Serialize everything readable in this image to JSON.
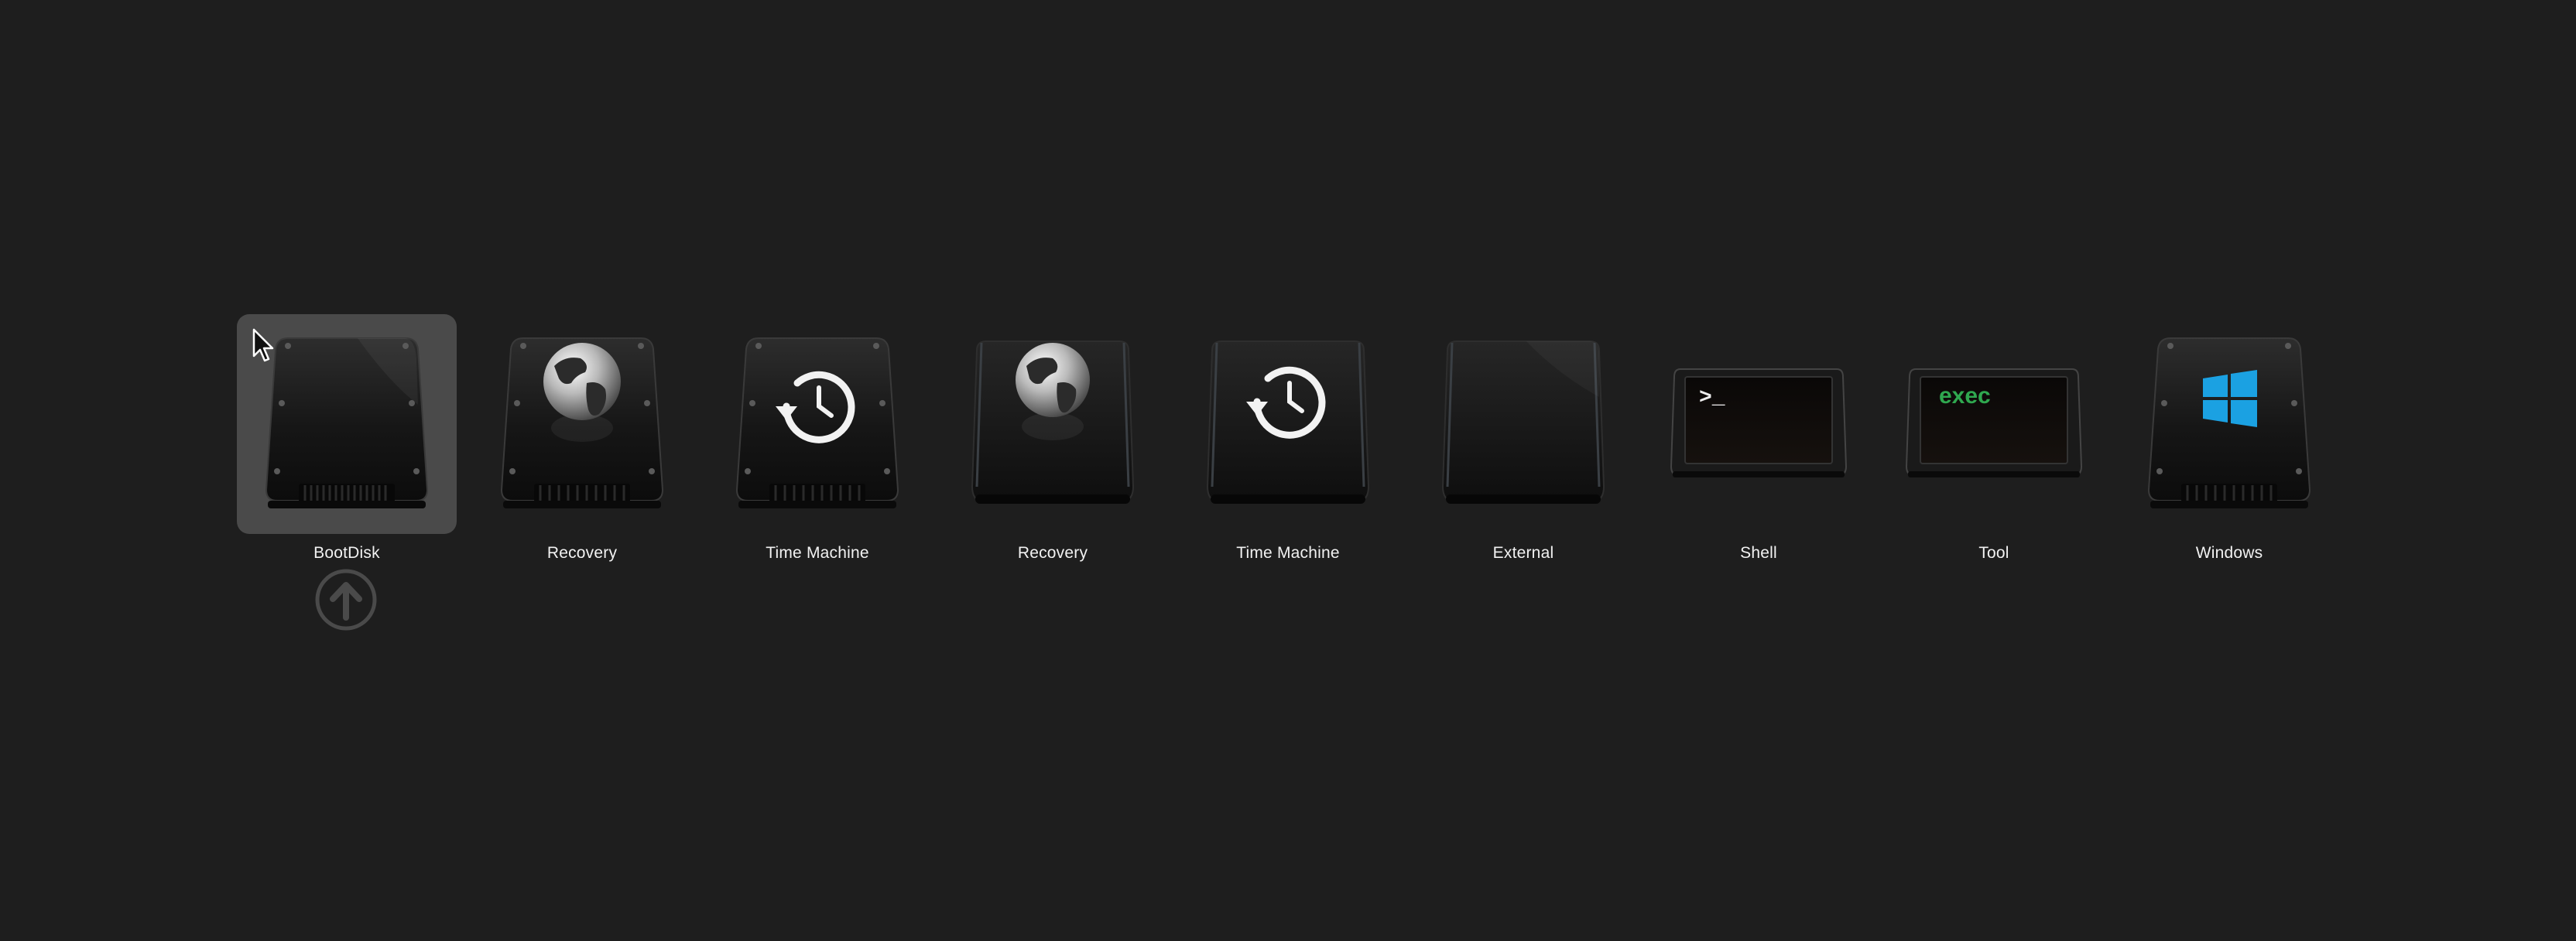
{
  "picker": {
    "entries": [
      {
        "label": "BootDisk",
        "icon": "hard-drive-icon",
        "selected": true
      },
      {
        "label": "Recovery",
        "icon": "recovery-globe-drive-icon",
        "selected": false
      },
      {
        "label": "Time Machine",
        "icon": "time-machine-drive-icon",
        "selected": false
      },
      {
        "label": "Recovery",
        "icon": "recovery-globe-external-drive-icon",
        "selected": false
      },
      {
        "label": "Time Machine",
        "icon": "time-machine-external-drive-icon",
        "selected": false
      },
      {
        "label": "External",
        "icon": "external-drive-icon",
        "selected": false
      },
      {
        "label": "Shell",
        "icon": "shell-terminal-icon",
        "prompt": ">_",
        "selected": false
      },
      {
        "label": "Tool",
        "icon": "tool-exec-icon",
        "text": "exec",
        "selected": false
      },
      {
        "label": "Windows",
        "icon": "windows-drive-icon",
        "selected": false
      }
    ],
    "selection_indicator_icon": "up-arrow-circle-icon",
    "cursor_icon": "mouse-pointer-icon"
  },
  "colors": {
    "background": "#1e1e1e",
    "selected_highlight": "#4a4a4a",
    "label_text": "#f2f2f2",
    "windows_blue": "#1ba1e2",
    "exec_green": "#2fa84f"
  }
}
